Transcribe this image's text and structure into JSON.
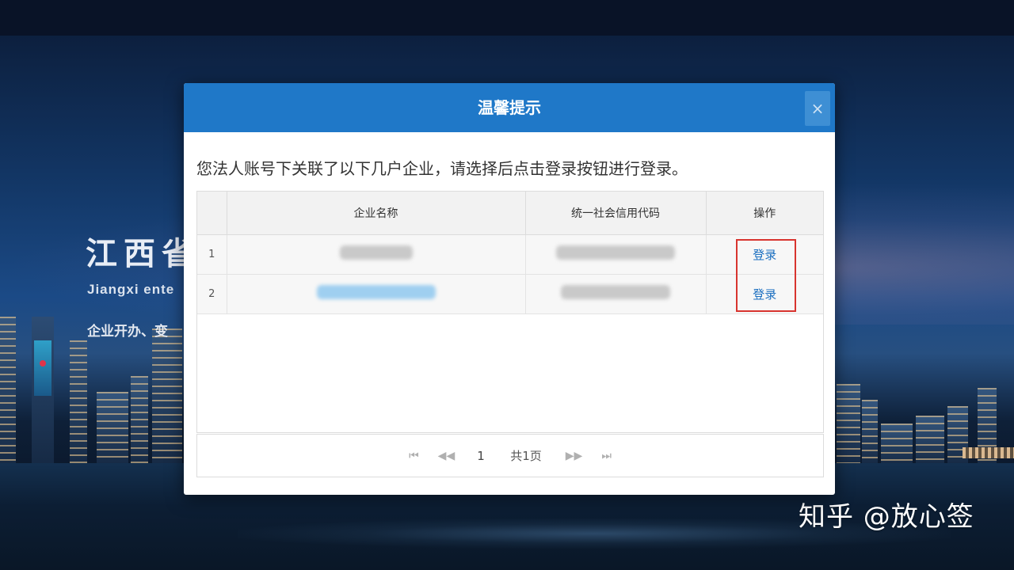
{
  "background": {
    "title": "江西省",
    "subtitle": "Jiangxi ente",
    "line": "企业开办、变",
    "watermark": "知乎 @放心签"
  },
  "dialog": {
    "title": "温馨提示",
    "close_label": "×",
    "notice": "您法人账号下关联了以下几户企业，请选择后点击登录按钮进行登录。",
    "table": {
      "headers": [
        "",
        "企业名称",
        "统一社会信用代码",
        "操作"
      ],
      "rows": [
        {
          "index": "1",
          "action": "登录"
        },
        {
          "index": "2",
          "action": "登录"
        }
      ]
    },
    "pager": {
      "first": "⏮",
      "prev": "◀◀",
      "page": "1",
      "total": "共1页",
      "next": "▶▶",
      "last": "⏭"
    }
  },
  "colors": {
    "header_blue": "#1f78c8",
    "link_blue": "#1b6fc0",
    "highlight_red": "#d8342f"
  }
}
